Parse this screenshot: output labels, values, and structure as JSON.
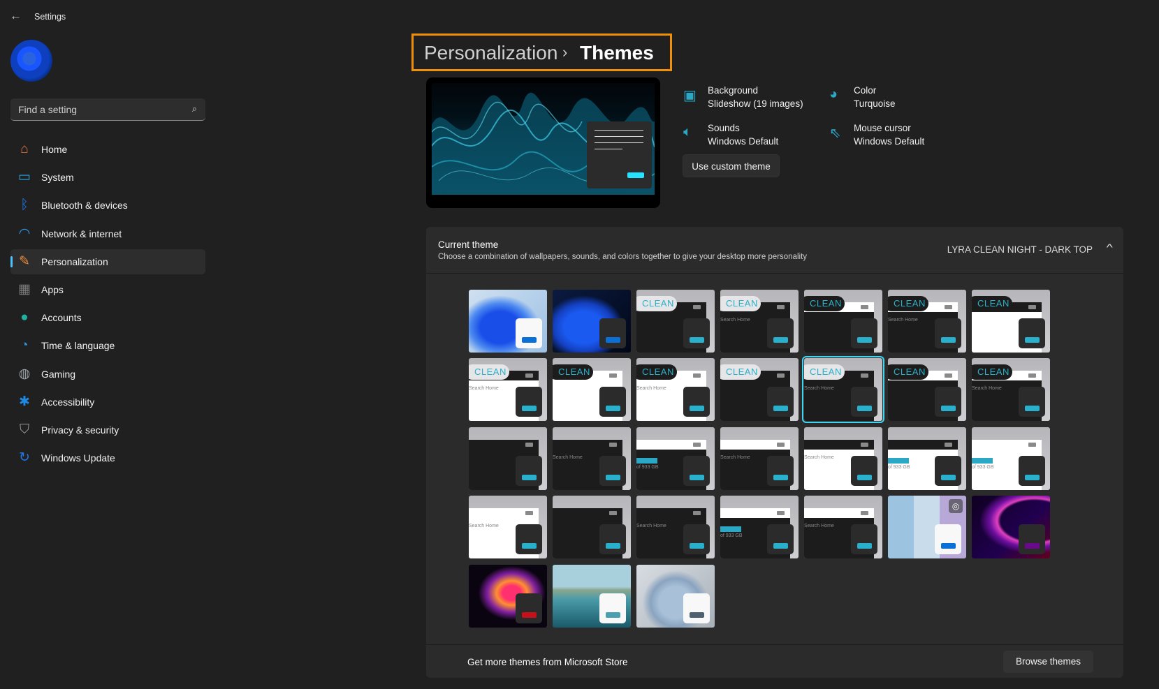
{
  "app": {
    "title": "Settings",
    "back_icon": "arrow-left-icon"
  },
  "search": {
    "placeholder": "Find a setting"
  },
  "sidebar": {
    "items": [
      {
        "label": "Home",
        "icon": "home-icon",
        "color": "#e8733a"
      },
      {
        "label": "System",
        "icon": "monitor-icon",
        "color": "#2aa8e0"
      },
      {
        "label": "Bluetooth & devices",
        "icon": "bluetooth-icon",
        "color": "#1e7ae8"
      },
      {
        "label": "Network & internet",
        "icon": "wifi-icon",
        "color": "#2d9be8"
      },
      {
        "label": "Personalization",
        "icon": "brush-icon",
        "color": "#e88a3a",
        "active": true
      },
      {
        "label": "Apps",
        "icon": "apps-icon",
        "color": "#7a7a7a"
      },
      {
        "label": "Accounts",
        "icon": "person-icon",
        "color": "#20b0a0"
      },
      {
        "label": "Time & language",
        "icon": "globe-clock-icon",
        "color": "#2a8fd8"
      },
      {
        "label": "Gaming",
        "icon": "gamepad-icon",
        "color": "#9aa0a6"
      },
      {
        "label": "Accessibility",
        "icon": "accessibility-icon",
        "color": "#1e8ae8"
      },
      {
        "label": "Privacy & security",
        "icon": "shield-icon",
        "color": "#9a9a9a"
      },
      {
        "label": "Windows Update",
        "icon": "update-icon",
        "color": "#1e7ae8"
      }
    ]
  },
  "breadcrumb": {
    "parent": "Personalization",
    "separator": "›",
    "current": "Themes"
  },
  "theme_info": [
    {
      "label": "Background",
      "value": "Slideshow (19 images)",
      "icon": "image-icon"
    },
    {
      "label": "Color",
      "value": "Turquoise",
      "icon": "palette-icon"
    },
    {
      "label": "Sounds",
      "value": "Windows Default",
      "icon": "speaker-icon"
    },
    {
      "label": "Mouse cursor",
      "value": "Windows Default",
      "icon": "cursor-icon"
    }
  ],
  "custom_button": "Use custom theme",
  "current_theme": {
    "title": "Current theme",
    "description": "Choose a combination of wallpapers, sounds, and colors together to give your desktop more personality",
    "value": "LYRA CLEAN NIGHT - DARK TOP",
    "expanded": true
  },
  "accent": "#29b0cc",
  "tiles": [
    {
      "wallpaper": "bloom-light",
      "dialog": "light",
      "accent": "#0a6fd6"
    },
    {
      "wallpaper": "bloom-dark",
      "dialog": "dark",
      "accent": "#0a6fd6"
    },
    {
      "badge": "light",
      "badge_text": "CLEAN",
      "bar": "dark",
      "body": "dark"
    },
    {
      "badge": "light",
      "badge_text": "CLEAN",
      "bar": "dark",
      "body": "dark",
      "caption": "Search Home"
    },
    {
      "badge": "dark",
      "badge_text": "CLEAN",
      "bar": "white",
      "body": "dark"
    },
    {
      "badge": "dark",
      "badge_text": "CLEAN",
      "bar": "white",
      "body": "dark",
      "caption": "Search Home"
    },
    {
      "badge": "dark",
      "badge_text": "CLEAN",
      "bar": "dark",
      "body": "white"
    },
    {
      "badge": "light",
      "badge_text": "CLEAN",
      "bar": "dark",
      "body": "white",
      "caption": "Search Home"
    },
    {
      "badge": "dark",
      "badge_text": "CLEAN",
      "bar": "white",
      "body": "white"
    },
    {
      "badge": "dark",
      "badge_text": "CLEAN",
      "bar": "white",
      "body": "white",
      "caption": "Search Home"
    },
    {
      "badge": "light",
      "badge_text": "CLEAN",
      "bar": "dark",
      "body": "dark"
    },
    {
      "badge": "light",
      "badge_text": "CLEAN",
      "bar": "dark",
      "body": "dark",
      "caption": "Search Home",
      "selected": true
    },
    {
      "badge": "dark",
      "badge_text": "CLEAN",
      "bar": "white",
      "body": "dark"
    },
    {
      "badge": "dark",
      "badge_text": "CLEAN",
      "bar": "white",
      "body": "dark",
      "caption": "Search Home"
    },
    {
      "bar": "dark",
      "body": "dark"
    },
    {
      "bar": "dark",
      "body": "dark",
      "caption": "Search Home"
    },
    {
      "bar": "white",
      "body": "dark",
      "caption": "of 933 GB",
      "progress": true
    },
    {
      "bar": "white",
      "body": "dark",
      "caption": "Search Home"
    },
    {
      "bar": "dark",
      "body": "white",
      "caption": "Search Home"
    },
    {
      "bar": "dark",
      "body": "white",
      "caption": "of 933 GB",
      "progress": true
    },
    {
      "bar": "white",
      "body": "white",
      "caption": "of 933 GB",
      "progress": true
    },
    {
      "bar": "white",
      "body": "white",
      "caption": "Search Home"
    },
    {
      "bar": "dark",
      "body": "dark"
    },
    {
      "bar": "dark",
      "body": "dark",
      "caption": "Search Home"
    },
    {
      "bar": "white",
      "body": "dark",
      "caption": "of 933 GB",
      "progress": true
    },
    {
      "bar": "white",
      "body": "dark",
      "caption": "Search Home"
    },
    {
      "wallpaper": "flowers",
      "dialog": "light",
      "accent": "#0a6fd6",
      "slideshow_icon": "slideshow-icon"
    },
    {
      "wallpaper": "glow",
      "dialog": "dark",
      "accent": "#6a0a8a"
    },
    {
      "wallpaper": "flower-red",
      "dialog": "dark",
      "accent": "#c8101a"
    },
    {
      "wallpaper": "lake",
      "dialog": "light",
      "accent": "#4a9fb0"
    },
    {
      "wallpaper": "bloom-pale",
      "dialog": "light",
      "accent": "#4f6070"
    }
  ],
  "footer": {
    "text": "Get more themes from Microsoft Store",
    "button": "Browse themes"
  }
}
